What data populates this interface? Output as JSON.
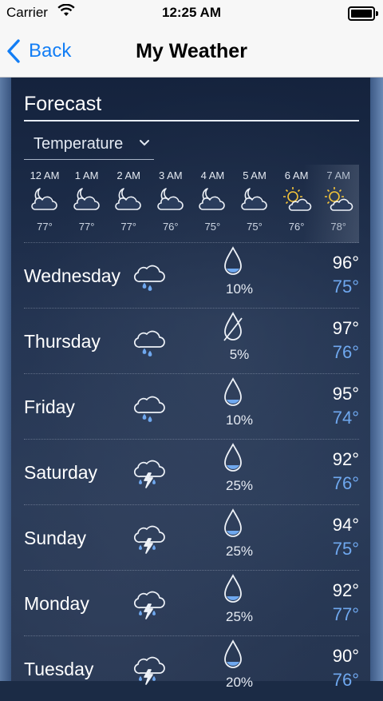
{
  "status": {
    "carrier": "Carrier",
    "time": "12:25 AM"
  },
  "nav": {
    "back_label": "Back",
    "title": "My Weather"
  },
  "forecast": {
    "title": "Forecast",
    "metric": "Temperature",
    "hourly": [
      {
        "time": "12 AM",
        "icon": "moon-cloud-icon",
        "temp": "77°"
      },
      {
        "time": "1 AM",
        "icon": "moon-cloud-icon",
        "temp": "77°"
      },
      {
        "time": "2 AM",
        "icon": "moon-cloud-icon",
        "temp": "77°"
      },
      {
        "time": "3 AM",
        "icon": "moon-cloud-icon",
        "temp": "76°"
      },
      {
        "time": "4 AM",
        "icon": "moon-cloud-icon",
        "temp": "75°"
      },
      {
        "time": "5 AM",
        "icon": "moon-cloud-icon",
        "temp": "75°"
      },
      {
        "time": "6 AM",
        "icon": "sun-cloud-icon",
        "temp": "76°"
      },
      {
        "time": "7 AM",
        "icon": "sun-cloud-icon",
        "temp": "78°"
      }
    ],
    "daily": [
      {
        "day": "Wednesday",
        "icon": "rain-cloud-icon",
        "precip_icon": "raindrop-icon",
        "precip": "10%",
        "high": "96°",
        "low": "75°"
      },
      {
        "day": "Thursday",
        "icon": "rain-cloud-icon",
        "precip_icon": "no-rain-icon",
        "precip": "5%",
        "high": "97°",
        "low": "76°"
      },
      {
        "day": "Friday",
        "icon": "rain-cloud-icon",
        "precip_icon": "raindrop-icon",
        "precip": "10%",
        "high": "95°",
        "low": "74°"
      },
      {
        "day": "Saturday",
        "icon": "thunderstorm-icon",
        "precip_icon": "raindrop-icon",
        "precip": "25%",
        "high": "92°",
        "low": "76°"
      },
      {
        "day": "Sunday",
        "icon": "thunderstorm-icon",
        "precip_icon": "raindrop-icon",
        "precip": "25%",
        "high": "94°",
        "low": "75°"
      },
      {
        "day": "Monday",
        "icon": "thunderstorm-icon",
        "precip_icon": "raindrop-icon",
        "precip": "25%",
        "high": "92°",
        "low": "77°"
      },
      {
        "day": "Tuesday",
        "icon": "thunderstorm-icon",
        "precip_icon": "raindrop-icon",
        "precip": "20%",
        "high": "90°",
        "low": "76°"
      }
    ]
  },
  "colors": {
    "accent": "#137ef5",
    "low_temp": "#6fa8ef",
    "sun": "#f3c43a"
  }
}
